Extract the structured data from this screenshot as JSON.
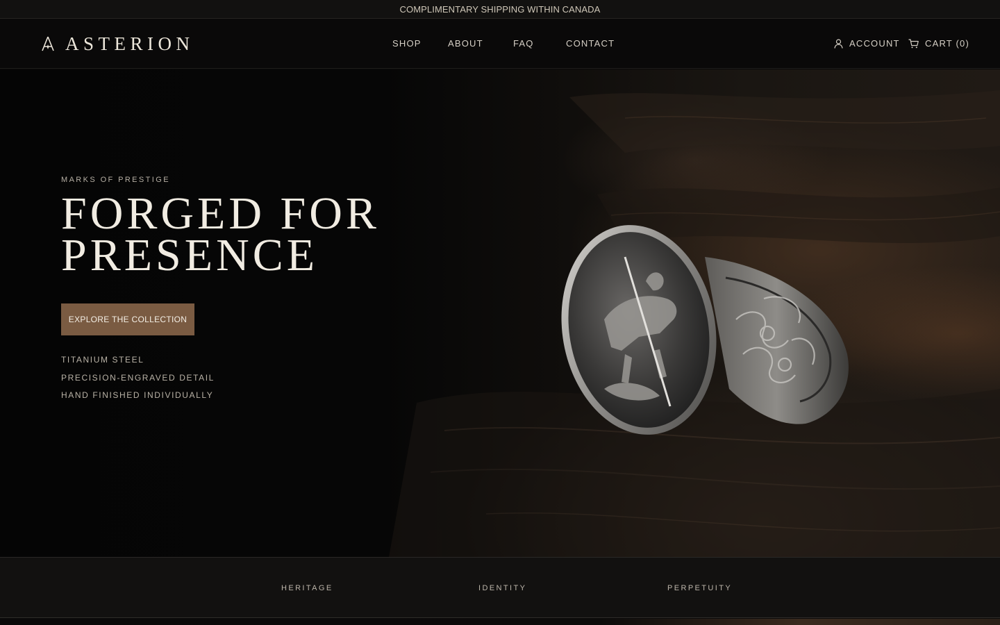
{
  "announcement": {
    "text": "COMPLIMENTARY SHIPPING WITHIN CANADA"
  },
  "header": {
    "logo_text": "ASTERION",
    "nav": [
      {
        "label": "SHOP"
      },
      {
        "label": "ABOUT"
      },
      {
        "label": "FAQ"
      },
      {
        "label": "CONTACT"
      }
    ],
    "account_label": "ACCOUNT",
    "cart_label": "CART (0)"
  },
  "hero": {
    "eyebrow": "MARKS OF PRESTIGE",
    "headline_line1": "FORGED FOR",
    "headline_line2": "PRESENCE",
    "cta_label": "EXPLORE THE COLLECTION",
    "features": [
      "TITANIUM STEEL",
      "PRECISION-ENGRAVED DETAIL",
      "HAND FINISHED INDIVIDUALLY"
    ]
  },
  "pillars": [
    {
      "label": "HERITAGE"
    },
    {
      "label": "IDENTITY"
    },
    {
      "label": "PERPETUITY"
    }
  ],
  "colors": {
    "background": "#0a0909",
    "accent": "#7a5b42",
    "text": "#d8d2c8",
    "headline": "#f1ece2"
  },
  "icons": {
    "logo": "logo-mark-icon",
    "account": "user-icon",
    "cart": "cart-icon"
  }
}
